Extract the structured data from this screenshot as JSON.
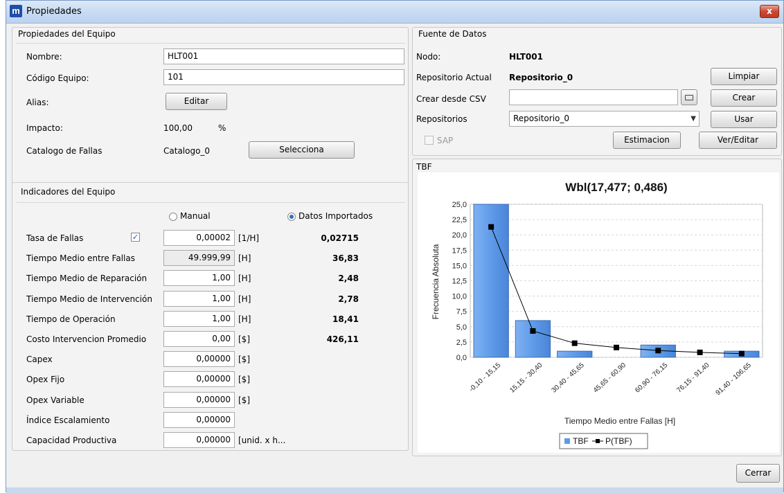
{
  "window": {
    "title": "Propiedades",
    "close_label": "x",
    "app_icon_letter": "m"
  },
  "equipo": {
    "panel_title": "Propiedades del Equipo",
    "nombre_label": "Nombre:",
    "nombre_value": "HLT001",
    "codigo_label": "Código Equipo:",
    "codigo_value": "101",
    "alias_label": "Alias:",
    "editar_label": "Editar",
    "impacto_label": "Impacto:",
    "impacto_value": "100,00",
    "impacto_unit": "%",
    "catalogo_label": "Catalogo de Fallas",
    "catalogo_value": "Catalogo_0",
    "selecciona_label": "Selecciona"
  },
  "indicadores": {
    "panel_title": "Indicadores del Equipo",
    "manual_label": "Manual",
    "importados_label": "Datos Importados",
    "rows": [
      {
        "label": "Tasa de Fallas",
        "value": "0,00002",
        "unit": "[1/H]",
        "imported": "0,02715"
      },
      {
        "label": "Tiempo Medio entre Fallas",
        "value": "49.999,99",
        "unit": "[H]",
        "imported": "36,83"
      },
      {
        "label": "Tiempo Medio de Reparación",
        "value": "1,00",
        "unit": "[H]",
        "imported": "2,48"
      },
      {
        "label": "Tiempo Medio de Intervención",
        "value": "1,00",
        "unit": "[H]",
        "imported": "2,78"
      },
      {
        "label": "Tiempo de Operación",
        "value": "1,00",
        "unit": "[H]",
        "imported": "18,41"
      },
      {
        "label": "Costo Intervencion Promedio",
        "value": "0,00",
        "unit": "[$]",
        "imported": "426,11"
      },
      {
        "label": "Capex",
        "value": "0,00000",
        "unit": "[$]",
        "imported": ""
      },
      {
        "label": "Opex Fijo",
        "value": "0,00000",
        "unit": "[$]",
        "imported": ""
      },
      {
        "label": "Opex Variable",
        "value": "0,00000",
        "unit": "[$]",
        "imported": ""
      },
      {
        "label": "Índice Escalamiento",
        "value": "0,00000",
        "unit": "",
        "imported": ""
      },
      {
        "label": "Capacidad Productiva",
        "value": "0,00000",
        "unit": "[unid. x h...",
        "imported": ""
      }
    ]
  },
  "fuente": {
    "panel_title": "Fuente de Datos",
    "nodo_label": "Nodo:",
    "nodo_value": "HLT001",
    "repo_actual_label": "Repositorio Actual",
    "repo_actual_value": "Repositorio_0",
    "limpiar_label": "Limpiar",
    "csv_label": "Crear desde CSV",
    "csv_value": "",
    "crear_label": "Crear",
    "repos_label": "Repositorios",
    "repos_selected": "Repositorio_0",
    "usar_label": "Usar",
    "sap_label": "SAP",
    "estimacion_label": "Estimacion",
    "ver_editar_label": "Ver/Editar"
  },
  "tbf_panel_title": "TBF",
  "cerrar_label": "Cerrar",
  "chart_data": {
    "type": "bar",
    "title": "Wbl(17,477; 0,486)",
    "xlabel": "Tiempo Medio entre Fallas [H]",
    "ylabel": "Frecuencia Absoluta",
    "ylim": [
      0,
      25
    ],
    "yticks": [
      "0,0",
      "2,5",
      "5,0",
      "7,5",
      "10,0",
      "12,5",
      "15,0",
      "17,5",
      "20,0",
      "22,5",
      "25,0"
    ],
    "categories": [
      "-0,10 - 15,15",
      "15,15 - 30,40",
      "30,40 - 45,65",
      "45,65 - 60,90",
      "60,90 - 76,15",
      "76,15 - 91,40",
      "91,40 - 106,65"
    ],
    "series": [
      {
        "name": "TBF",
        "kind": "bar",
        "color": "#5f9be8",
        "values": [
          25,
          6,
          1,
          0,
          2,
          0,
          1
        ]
      },
      {
        "name": "P(TBF)",
        "kind": "line",
        "color": "#000000",
        "values": [
          21.3,
          4.3,
          2.3,
          1.6,
          1.1,
          0.8,
          0.6
        ]
      }
    ],
    "grid": true,
    "legend_position": "bottom"
  }
}
